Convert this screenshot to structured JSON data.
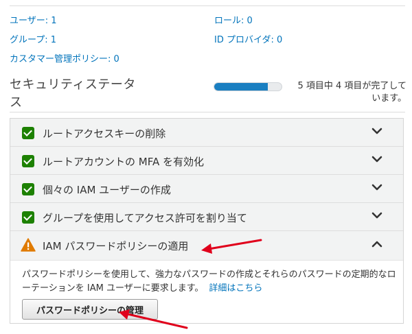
{
  "summary": {
    "users": "ユーザー: 1",
    "roles": "ロール: 0",
    "groups": "グループ: 1",
    "id_providers": "ID プロバイダ: 0",
    "customer_policies": "カスタマー管理ポリシー: 0"
  },
  "security_status": {
    "title_line1": "セキュリティステータ",
    "title_line2": "ス",
    "progress_fraction": 0.8,
    "status_line1": "5 項目中 4 項目が完了して",
    "status_line2": "います。"
  },
  "checklist": [
    {
      "label": "ルートアクセスキーの削除",
      "state": "complete"
    },
    {
      "label": "ルートアカウントの MFA を有効化",
      "state": "complete"
    },
    {
      "label": "個々の IAM ユーザーの作成",
      "state": "complete"
    },
    {
      "label": "グループを使用してアクセス許可を割り当て",
      "state": "complete"
    },
    {
      "label": "IAM パスワードポリシーの適用",
      "state": "warning",
      "expanded": true
    }
  ],
  "expanded_panel": {
    "description": "パスワードポリシーを使用して、強力なパスワードの作成とそれらのパスワードの定期的なローテーションを IAM ユーザーに要求します。",
    "details_link": "詳細はこちら",
    "manage_button": "パスワードポリシーの管理"
  },
  "colors": {
    "link": "#0073bb",
    "check": "#1d8102",
    "warning": "#e07b00",
    "progress": "#1a7fc1",
    "annotation_arrow": "#e0001b"
  }
}
